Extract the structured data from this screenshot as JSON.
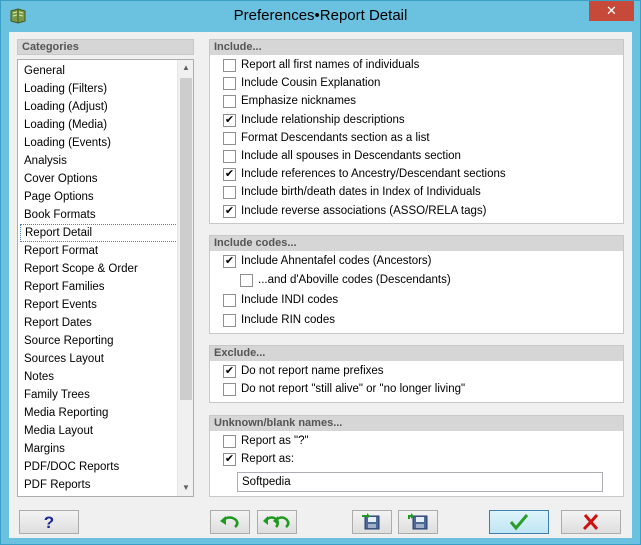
{
  "window": {
    "title": "Preferences•Report Detail",
    "close": "✕"
  },
  "categories": {
    "header": "Categories",
    "items": [
      "General",
      "Loading (Filters)",
      "Loading (Adjust)",
      "Loading (Media)",
      "Loading (Events)",
      "Analysis",
      "Cover Options",
      "Page Options",
      "Book Formats",
      "Report Detail",
      "Report Format",
      "Report Scope & Order",
      "Report Families",
      "Report Events",
      "Report Dates",
      "Source Reporting",
      "Sources Layout",
      "Notes",
      "Family Trees",
      "Media Reporting",
      "Media Layout",
      "Margins",
      "PDF/DOC Reports",
      "PDF Reports"
    ],
    "selected": "Report Detail"
  },
  "include": {
    "header": "Include...",
    "options": [
      {
        "label": "Report all first names of individuals",
        "checked": false
      },
      {
        "label": "Include Cousin Explanation",
        "checked": false
      },
      {
        "label": "Emphasize nicknames",
        "checked": false
      },
      {
        "label": "Include relationship descriptions",
        "checked": true
      },
      {
        "label": "Format Descendants section as a list",
        "checked": false
      },
      {
        "label": "Include all spouses in Descendants section",
        "checked": false
      },
      {
        "label": "Include references to Ancestry/Descendant sections",
        "checked": true
      },
      {
        "label": "Include birth/death dates in Index of Individuals",
        "checked": false
      },
      {
        "label": "Include reverse associations (ASSO/RELA tags)",
        "checked": true
      }
    ]
  },
  "include_codes": {
    "header": "Include codes...",
    "ahnentafel": {
      "label": "Include Ahnentafel codes (Ancestors)",
      "checked": true
    },
    "daboville": {
      "label": "...and d'Aboville codes (Descendants)",
      "checked": false
    },
    "indi": {
      "label": "Include INDI codes",
      "checked": false
    },
    "rin": {
      "label": "Include RIN codes",
      "checked": false
    }
  },
  "exclude": {
    "header": "Exclude...",
    "name_prefixes": {
      "label": "Do not report name prefixes",
      "checked": true
    },
    "still_alive": {
      "label": "Do not report \"still alive\" or \"no longer living\"",
      "checked": false
    }
  },
  "unknown_names": {
    "header": "Unknown/blank names...",
    "report_question": {
      "label": "Report as \"?\"",
      "checked": false
    },
    "report_as": {
      "label": "Report as:",
      "checked": true
    },
    "report_as_value": "Softpedia"
  },
  "colors": {
    "accent": "#6ac1e0",
    "close": "#c7493a",
    "ok_check": "#2a9d2a",
    "cancel_x": "#d01010",
    "undo_arrow": "#1e9a1e"
  },
  "icons": {
    "help": "question-mark-icon",
    "undo": "undo-arrow-icon",
    "undo_all": "undo-all-arrows-icon",
    "save": "save-disk-icon",
    "load": "load-disk-icon",
    "ok": "checkmark-icon",
    "cancel": "x-mark-icon"
  }
}
